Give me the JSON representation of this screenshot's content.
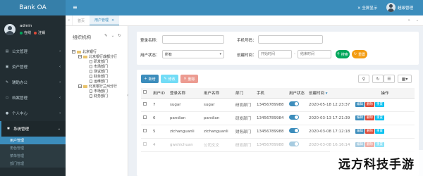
{
  "app": {
    "brand": "Bank OA"
  },
  "user_panel": {
    "name": "admin",
    "status_online": "在线",
    "status_logout": "注销"
  },
  "sidebar": {
    "items": [
      {
        "label": "公文管理",
        "icon": "document-icon"
      },
      {
        "label": "资产管理",
        "icon": "cart-icon"
      },
      {
        "label": "辅助办公",
        "icon": "edit-icon"
      },
      {
        "label": "档案管理",
        "icon": "folder-icon"
      },
      {
        "label": "个人中心",
        "icon": "user-icon"
      },
      {
        "label": "系统管理",
        "icon": "gear-icon"
      }
    ],
    "submenu": [
      {
        "label": "用户管理"
      },
      {
        "label": "角色管理"
      },
      {
        "label": "菜单管理"
      },
      {
        "label": "部门管理"
      }
    ]
  },
  "header": {
    "fullscreen": "全屏显示",
    "username": "超级管理"
  },
  "tabs": {
    "home": "首页",
    "current": "用户管理",
    "close": "×"
  },
  "org": {
    "title": "组织机构",
    "tree": [
      {
        "label": "北京银行",
        "level": 0,
        "type": "folder"
      },
      {
        "label": "北京银行成都分行",
        "level": 1,
        "type": "folder"
      },
      {
        "label": "研发部门",
        "level": 2,
        "type": "file"
      },
      {
        "label": "市场部门",
        "level": 2,
        "type": "file"
      },
      {
        "label": "测试部门",
        "level": 2,
        "type": "file"
      },
      {
        "label": "财务部门",
        "level": 2,
        "type": "file"
      },
      {
        "label": "运维部门",
        "level": 2,
        "type": "file"
      },
      {
        "label": "北京银行兰州分行",
        "level": 1,
        "type": "folder"
      },
      {
        "label": "市场部门",
        "level": 2,
        "type": "file"
      },
      {
        "label": "财务部门",
        "level": 2,
        "type": "file"
      }
    ]
  },
  "search": {
    "login_label": "登录名称：",
    "phone_label": "手机号码：",
    "status_label": "用户状态：",
    "status_value": "所有",
    "created_label": "创建时间：",
    "start_placeholder": "开始时间",
    "end_placeholder": "结束时间",
    "search_btn": "搜索",
    "reset_btn": "重置"
  },
  "toolbar": {
    "add": "新增",
    "edit": "修改",
    "delete": "删除"
  },
  "table": {
    "headers": [
      "用户ID",
      "登录名称",
      "用户名称",
      "部门",
      "手机",
      "用户状态",
      "创建时间",
      "操作"
    ],
    "rows": [
      {
        "id": "7",
        "login": "sugar",
        "name": "sugar",
        "dept": "研发部门",
        "phone": "13456789988",
        "created": "2020-05-18 12:23:37"
      },
      {
        "id": "6",
        "login": "pandian",
        "name": "pandian",
        "dept": "研发部门",
        "phone": "13456789984",
        "created": "2020-03-13 17:21:39"
      },
      {
        "id": "5",
        "login": "zichanguanli",
        "name": "zichanguanli",
        "dept": "财务部门",
        "phone": "13456789988",
        "created": "2020-03-08 17:12:18"
      },
      {
        "id": "4",
        "login": "gwshichuan",
        "name": "公司文文",
        "dept": "研发部门",
        "phone": "13456789988",
        "created": "2020-03-08 16:16:14"
      }
    ],
    "actions": {
      "edit": "编辑",
      "delete": "删除",
      "reset": "重置"
    }
  },
  "colors": {
    "header_blue": "#3c8dbc",
    "sidebar_dark": "#222d32",
    "danger": "#dd4b39",
    "success": "#00a65a",
    "warning": "#f39c12",
    "info": "#00c0ef"
  },
  "watermark": {
    "text": "远方科技手游"
  }
}
